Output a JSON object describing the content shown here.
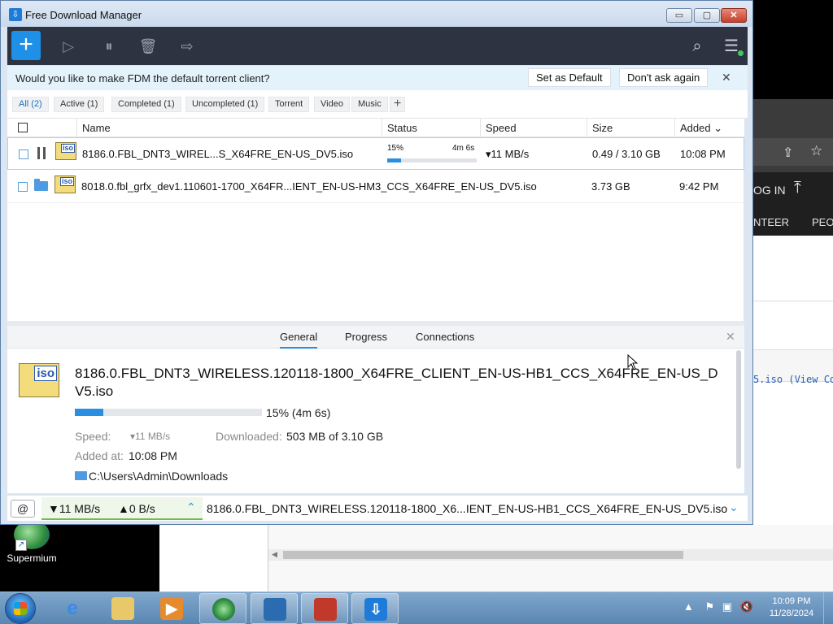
{
  "window": {
    "title": "Free Download Manager",
    "controls": {
      "minimize": "▭",
      "maximize": "▢",
      "close": "✕"
    }
  },
  "toolbar": {
    "add": "+",
    "icons": [
      "play-icon",
      "pause-all-icon",
      "trash-icon",
      "move-folder-icon",
      "search-icon",
      "hamburger-menu-icon"
    ]
  },
  "notification": {
    "message": "Would you like to make FDM the default torrent client?",
    "set_default": "Set as Default",
    "dont_ask": "Don't ask again",
    "close": "✕"
  },
  "filters": [
    {
      "label": "All (2)",
      "active": true
    },
    {
      "label": "Active (1)",
      "active": false
    },
    {
      "label": "Completed (1)",
      "active": false
    },
    {
      "label": "Uncompleted (1)",
      "active": false
    },
    {
      "label": "Torrent",
      "active": false
    },
    {
      "label": "Video",
      "active": false
    },
    {
      "label": "Music",
      "active": false
    }
  ],
  "filter_add": "+",
  "columns": {
    "name": "Name",
    "status": "Status",
    "speed": "Speed",
    "size": "Size",
    "added": "Added",
    "sort_indicator": "⌄"
  },
  "downloads": [
    {
      "name": "8186.0.FBL_DNT3_WIREL...S_X64FRE_EN-US_DV5.iso",
      "file_tag": "iso",
      "progress_text": "15%",
      "progress": 0.15,
      "eta": "4m 6s",
      "speed": "▾11 MB/s",
      "size": "0.49 / 3.10 GB",
      "added": "10:08 PM",
      "state": "downloading"
    },
    {
      "name": "8018.0.fbl_grfx_dev1.110601-1700_X64FR...IENT_EN-US-HM3_CCS_X64FRE_EN-US_DV5.iso",
      "file_tag": "iso",
      "size": "3.73 GB",
      "added": "9:42 PM",
      "state": "completed"
    }
  ],
  "details": {
    "tabs": [
      "General",
      "Progress",
      "Connections"
    ],
    "active_tab": "General",
    "close": "✕",
    "file_tag": "iso",
    "full_name": "8186.0.FBL_DNT3_WIRELESS.120118-1800_X64FRE_CLIENT_EN-US-HB1_CCS_X64FRE_EN-US_DV5.iso",
    "progress": 0.15,
    "progress_text": "15% (4m 6s)",
    "speed_label": "Speed:",
    "speed_value": "▾11 MB/s",
    "downloaded_label": "Downloaded:",
    "downloaded_value": "503 MB of 3.10 GB",
    "added_label": "Added at:",
    "added_value": "10:08 PM",
    "path": "C:\\Users\\Admin\\Downloads"
  },
  "statusbar": {
    "snail": "🐌",
    "down_speed": "▼11 MB/s",
    "up_speed": "▲0 B/s",
    "expand": "⌃",
    "current_file": "8186.0.FBL_DNT3_WIRELESS.120118-1800_X6...IENT_EN-US-HB1_CCS_X64FRE_EN-US_DV5.iso",
    "collapse": "⌄"
  },
  "background_browser": {
    "nav_login": "OG IN",
    "nav_item_1": "NTEER",
    "nav_item_2": "PEO",
    "code_text": "5.iso (View Co"
  },
  "desktop": {
    "icon_label": "Supermium"
  },
  "taskbar": {
    "time": "10:09 PM",
    "date": "11/28/2024",
    "tray_icons": [
      "show-hidden-icons-icon",
      "flag-icon",
      "network-icon",
      "volume-muted-icon"
    ]
  },
  "colors": {
    "accent": "#1e90e8",
    "toolbar_bg": "#2d3340",
    "progress": "#2a8fe0",
    "notification_bg": "#e3f2fb"
  }
}
